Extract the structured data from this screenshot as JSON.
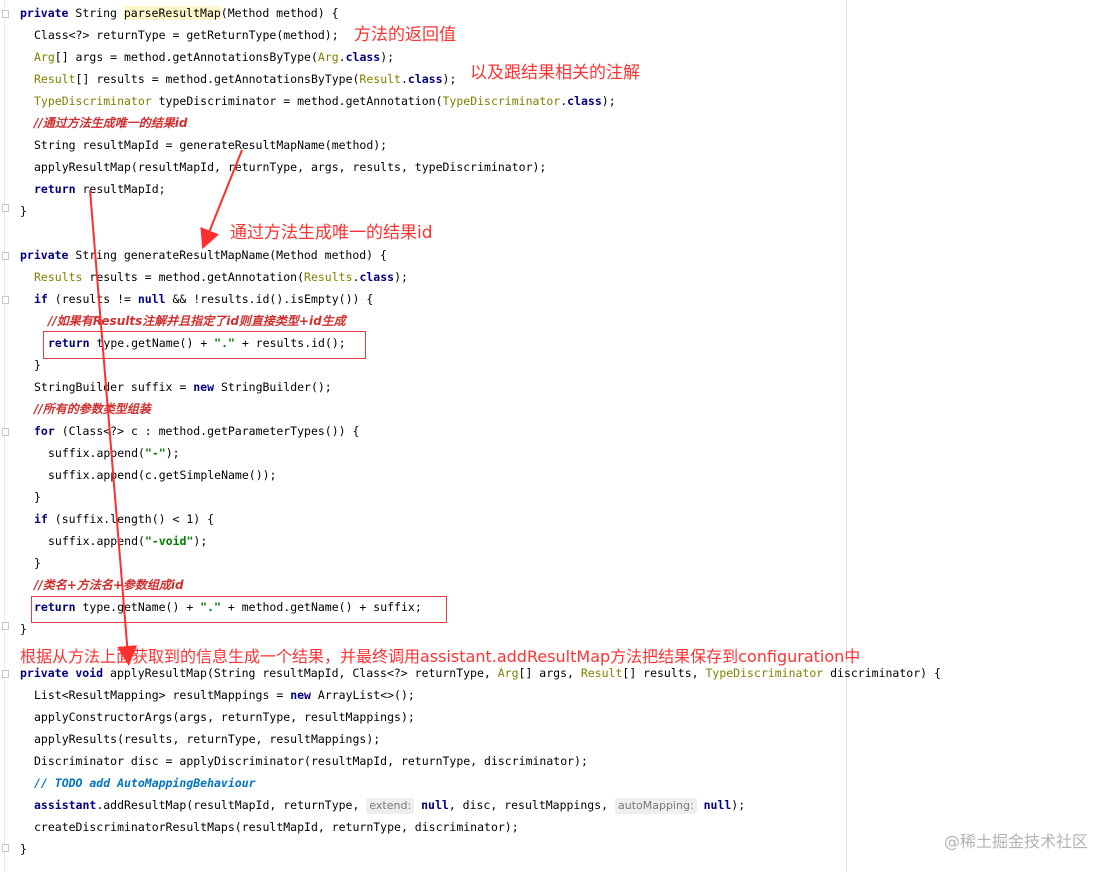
{
  "code": {
    "l1": {
      "kw": "private",
      "t1": " String ",
      "method": "parseResultMap",
      "t2": "(Method method) {"
    },
    "l2": {
      "t1": "Class<?> returnType = getReturnType(method);"
    },
    "l3": {
      "cls": "Arg",
      "t1": "[] args = method.getAnnotationsByType(",
      "cls2": "Arg",
      "t2": ".",
      "kw": "class",
      "t3": ");"
    },
    "l4": {
      "cls": "Result",
      "t1": "[] results = method.getAnnotationsByType(",
      "cls2": "Result",
      "t2": ".",
      "kw": "class",
      "t3": ");"
    },
    "l5": {
      "cls": "TypeDiscriminator",
      "t1": " typeDiscriminator = method.getAnnotation(",
      "cls2": "TypeDiscriminator",
      "t2": ".",
      "kw": "class",
      "t3": ");"
    },
    "l6": {
      "cmt": "//通过方法生成唯一的结果id"
    },
    "l7": {
      "t1": "String resultMapId = generateResultMapName(method);"
    },
    "l8": {
      "t1": "applyResultMap(resultMapId, returnType, args, results, typeDiscriminator);"
    },
    "l9": {
      "kw": "return",
      "t1": " resultMapId;"
    },
    "l10": {
      "t1": "}"
    },
    "l11": {
      "kw": "private",
      "t1": " String generateResultMapName(Method method) {"
    },
    "l12": {
      "cls": "Results",
      "t1": " results = method.getAnnotation(",
      "cls2": "Results",
      "t2": ".",
      "kw": "class",
      "t3": ");"
    },
    "l13": {
      "kw": "if",
      "t1": " (results != ",
      "kw2": "null",
      "t2": " && !results.id().isEmpty()) {"
    },
    "l14": {
      "cmt": "//如果有Results注解并且指定了id则直接类型+id生成"
    },
    "l15": {
      "kw": "return",
      "t1": " type.getName() + ",
      "str": "\".\"",
      "t2": " + results.id();"
    },
    "l16": {
      "t1": "}"
    },
    "l17": {
      "t1": "StringBuilder suffix = ",
      "kw": "new",
      "t2": " StringBuilder();"
    },
    "l18": {
      "cmt": "//所有的参数类型组装"
    },
    "l19": {
      "kw": "for",
      "t1": " (Class<?> c : method.getParameterTypes()) {"
    },
    "l20": {
      "t1": "suffix.append(",
      "str": "\"-\"",
      "t2": ");"
    },
    "l21": {
      "t1": "suffix.append(c.getSimpleName());"
    },
    "l22": {
      "t1": "}"
    },
    "l23": {
      "kw": "if",
      "t1": " (suffix.length() < 1) {"
    },
    "l24": {
      "t1": "suffix.append(",
      "str": "\"-void\"",
      "t2": ");"
    },
    "l25": {
      "t1": "}"
    },
    "l26": {
      "cmt": "//类名+方法名+参数组成id"
    },
    "l27": {
      "kw": "return",
      "t1": " type.getName() + ",
      "str": "\".\"",
      "t2": " + method.getName() + suffix;"
    },
    "l28": {
      "t1": "}"
    },
    "l29": {
      "kw": "private void",
      "t1": " applyResultMap(String resultMapId, Class<?> returnType, ",
      "cls": "Arg",
      "t2": "[] args, ",
      "cls2": "Result",
      "t3": "[] results, ",
      "cls3": "TypeDiscriminator",
      "t4": " discriminator) {"
    },
    "l30": {
      "t1": "List<ResultMapping> resultMappings = ",
      "kw": "new",
      "t2": " ArrayList<>();"
    },
    "l31": {
      "t1": "applyConstructorArgs(args, returnType, resultMappings);"
    },
    "l32": {
      "t1": "applyResults(results, returnType, resultMappings);"
    },
    "l33": {
      "t1": "Discriminator disc = applyDiscriminator(resultMapId, returnType, discriminator);"
    },
    "l34": {
      "todo": "// TODO add AutoMappingBehaviour"
    },
    "l35": {
      "kw": "assistant",
      "t1": ".addResultMap(resultMapId, returnType, ",
      "hint1": "extend:",
      "kw2": "null",
      "t2": ", disc, resultMappings, ",
      "hint2": "autoMapping:",
      "kw3": "null",
      "t3": ");"
    },
    "l36": {
      "t1": "createDiscriminatorResultMaps(resultMapId, returnType, discriminator);"
    },
    "l37": {
      "t1": "}"
    }
  },
  "annotations": {
    "return_type": "方法的返回值",
    "related_annotations": "以及跟结果相关的注解",
    "unique_id": "通过方法生成唯一的结果id",
    "generate_result": "根据从方法上面获取到的信息生成一个结果，并最终调用assistant.addResultMap方法把结果保存到configuration中"
  },
  "watermark": "@稀土掘金技术社区",
  "colors": {
    "keyword": "#000080",
    "annotation_class": "#808000",
    "string": "#008000",
    "comment": "#d03030",
    "todo": "#0073bf",
    "note": "#ff3333"
  }
}
